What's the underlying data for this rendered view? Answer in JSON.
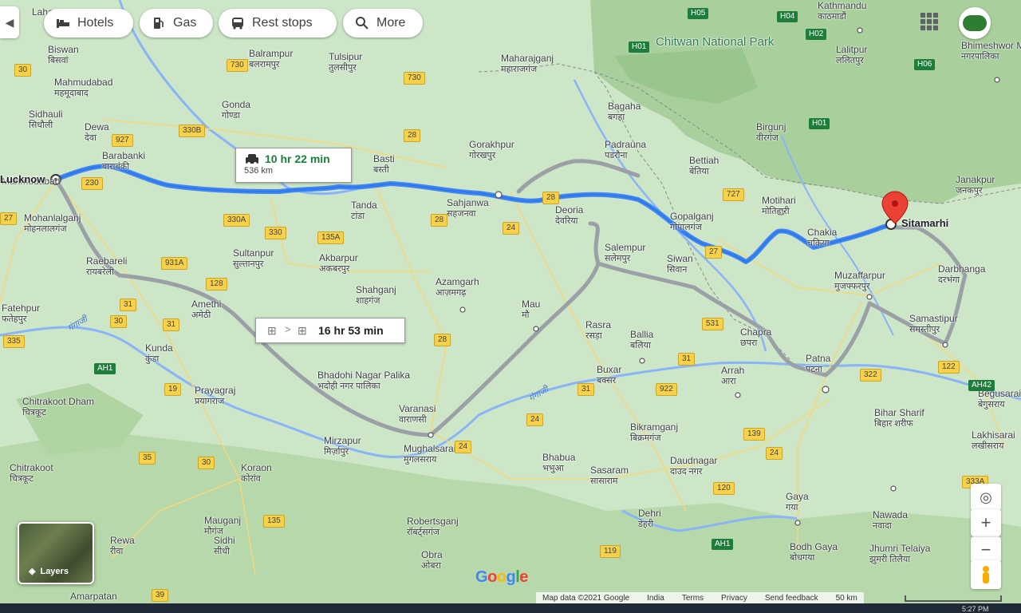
{
  "toolbar": {
    "hotels": "Hotels",
    "gas": "Gas",
    "rest_stops": "Rest stops",
    "more": "More"
  },
  "routes": {
    "driving": {
      "time": "10 hr 22 min",
      "distance": "536 km"
    },
    "transit": {
      "time": "16 hr 53 min"
    }
  },
  "places": {
    "origin": "Lucknow",
    "destination": "Sitamarhi",
    "labels": [
      {
        "en": "Laharpur"
      },
      {
        "en": "Biswan",
        "hi": "बिसवां"
      },
      {
        "en": "Mahmudabad",
        "hi": "महमूदाबाद"
      },
      {
        "en": "Sidhauli",
        "hi": "सिधौली"
      },
      {
        "en": "Dewa",
        "hi": "देवा"
      },
      {
        "en": "Barabanki",
        "hi": "बाराबंकी"
      },
      {
        "en": "Mohanlalganj",
        "hi": "मोहनलालगंज"
      },
      {
        "en": "Raebareli",
        "hi": "रायबरेली"
      },
      {
        "en": "Fatehpur",
        "hi": "फतेहपुर"
      },
      {
        "en": "Kunda",
        "hi": "कुंडा"
      },
      {
        "en": "Chitrakoot Dham",
        "hi": "चित्रकूट"
      },
      {
        "en": "Chitrakoot",
        "hi": "चित्रकूट"
      },
      {
        "en": "Rewa",
        "hi": "रीवा"
      },
      {
        "en": "Amarpatan"
      },
      {
        "en": "Balrampur",
        "hi": "बलरामपुर"
      },
      {
        "en": "Tulsipur",
        "hi": "तुलसीपुर"
      },
      {
        "en": "Gonda",
        "hi": "गोण्डा"
      },
      {
        "en": "Basti",
        "hi": "बस्ती"
      },
      {
        "en": "Tanda",
        "hi": "टांडा"
      },
      {
        "en": "Sultanpur",
        "hi": "सुल्तानपुर"
      },
      {
        "en": "Akbarpur",
        "hi": "अकबरपुर"
      },
      {
        "en": "Shahganj",
        "hi": "शाहगंज"
      },
      {
        "en": "Amethi",
        "hi": "अमेठी"
      },
      {
        "en": "Prayagraj",
        "hi": "प्रयागराज"
      },
      {
        "en": "Bhadohi Nagar Palika",
        "hi": "भदोही नगर पालिका"
      },
      {
        "en": "Mirzapur",
        "hi": "मिर्ज़ापुर"
      },
      {
        "en": "Varanasi",
        "hi": "वाराणसी"
      },
      {
        "en": "Mughalsarai",
        "hi": "मुगलसराय"
      },
      {
        "en": "Koraon",
        "hi": "कोरांव"
      },
      {
        "en": "Mauganj",
        "hi": "मौगंज"
      },
      {
        "en": "Sidhi",
        "hi": "सीधी"
      },
      {
        "en": "Robertsganj",
        "hi": "रॉबर्ट्सगंज"
      },
      {
        "en": "Obra",
        "hi": "ओबरा"
      },
      {
        "en": "Azamgarh",
        "hi": "आज़मगढ़"
      },
      {
        "en": "Mau",
        "hi": "मौ"
      },
      {
        "en": "Rasra",
        "hi": "रसड़ा"
      },
      {
        "en": "Ballia",
        "hi": "बलिया"
      },
      {
        "en": "Buxar",
        "hi": "बक्सर"
      },
      {
        "en": "Arrah",
        "hi": "आरा"
      },
      {
        "en": "Bhabua",
        "hi": "भभुआ"
      },
      {
        "en": "Sasaram",
        "hi": "सासाराम"
      },
      {
        "en": "Dehri",
        "hi": "डेहरी"
      },
      {
        "en": "Bikramganj",
        "hi": "बिक्रमगंज"
      },
      {
        "en": "Daudnagar",
        "hi": "दाउद नगर"
      },
      {
        "en": "Gaya",
        "hi": "गया"
      },
      {
        "en": "Bodh Gaya",
        "hi": "बोधगया"
      },
      {
        "en": "Nawada",
        "hi": "नवादा"
      },
      {
        "en": "Jhumri Telaiya",
        "hi": "झुमरी तिलैया"
      },
      {
        "en": "Maharajganj",
        "hi": "महाराजगंज"
      },
      {
        "en": "Gorakhpur",
        "hi": "गोरखपुर"
      },
      {
        "en": "Sahjanwa",
        "hi": "सहजनवा"
      },
      {
        "en": "Deoria",
        "hi": "देवरिया"
      },
      {
        "en": "Salempur",
        "hi": "सलेमपुर"
      },
      {
        "en": "Padrauna",
        "hi": "पडरौना"
      },
      {
        "en": "Bagaha",
        "hi": "बगहा"
      },
      {
        "en": "Siwan",
        "hi": "सिवान"
      },
      {
        "en": "Gopalganj",
        "hi": "गोपालगंज"
      },
      {
        "en": "Bettiah",
        "hi": "बेतिया"
      },
      {
        "en": "Birgunj",
        "hi": "वीरगंज"
      },
      {
        "en": "Motihari",
        "hi": "मोतिहारी"
      },
      {
        "en": "Chakia",
        "hi": "चकिया"
      },
      {
        "en": "Chapra",
        "hi": "छपरा"
      },
      {
        "en": "Patna",
        "hi": "पटना"
      },
      {
        "en": "Muzaffarpur",
        "hi": "मुजफ्फरपुर"
      },
      {
        "en": "Darbhanga",
        "hi": "दरभंगा"
      },
      {
        "en": "Samastipur",
        "hi": "समस्तीपुर"
      },
      {
        "en": "Bihar Sharif",
        "hi": "बिहार शरीफ"
      },
      {
        "en": "Begusarai",
        "hi": "बेगुसराय"
      },
      {
        "en": "Lakhisarai",
        "hi": "लखीसराय"
      },
      {
        "en": "Janakpur",
        "hi": "जनकपुर"
      },
      {
        "en": "Kathmandu",
        "hi": "काठमाडौं"
      },
      {
        "en": "Lalitpur",
        "hi": "ललितपुर"
      },
      {
        "en": "Bhimeshwor Municipality",
        "hi": "नगरपालिका"
      },
      {
        "en": "Chitwan National Park"
      },
      {
        "en": "Mahmudabad"
      }
    ],
    "rivers": [
      "गंगाजी",
      "गंगाजी"
    ]
  },
  "highways": [
    "730",
    "330B",
    "927",
    "30",
    "230",
    "27",
    "330A",
    "330",
    "135A",
    "931A",
    "128",
    "31",
    "30",
    "31",
    "335",
    "AH1",
    "19",
    "35",
    "30",
    "135",
    "39",
    "28",
    "730",
    "28",
    "24",
    "28",
    "24",
    "31",
    "28",
    "24",
    "922",
    "139",
    "24",
    "120",
    "531",
    "31",
    "727",
    "27",
    "322",
    "122",
    "AH42",
    "333A",
    "AH1",
    "119",
    "H05",
    "H04",
    "H02",
    "H01",
    "H06",
    "H01"
  ],
  "map_controls": {
    "layers_label": "Layers",
    "zoom_in": "+",
    "zoom_out": "−"
  },
  "attribution": {
    "map_data": "Map data ©2021 Google",
    "country": "India",
    "terms": "Terms",
    "privacy": "Privacy",
    "feedback": "Send feedback",
    "scale": "50 km"
  },
  "logo": "Google",
  "clock": "5:27 PM"
}
